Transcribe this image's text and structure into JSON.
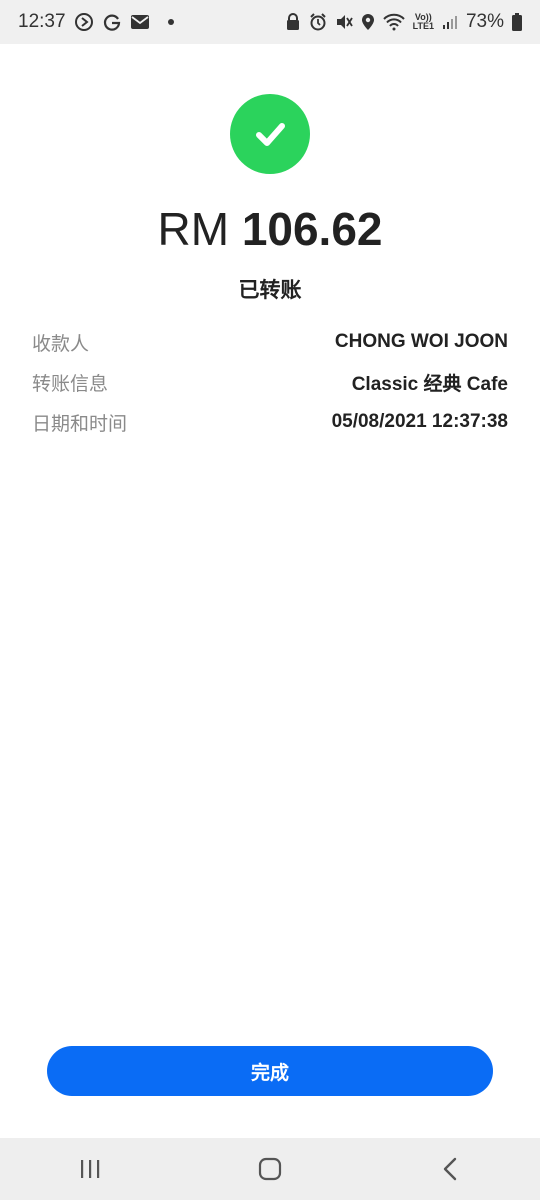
{
  "status_bar": {
    "time": "12:37",
    "battery": "73%",
    "left_icons": [
      "play-circle-icon",
      "google-icon",
      "mail-icon",
      "notification-dot"
    ],
    "right_icons": [
      "recycle-lock-icon",
      "alarm-icon",
      "mute-icon",
      "location-icon",
      "wifi-icon",
      "volte-icon",
      "signal-icon",
      "battery-icon"
    ],
    "volte_label_top": "Vo))",
    "volte_label_bottom": "LTE1"
  },
  "result": {
    "currency": "RM",
    "amount": "106.62",
    "status": "已转账",
    "success_color": "#2bd35c"
  },
  "details": [
    {
      "label": "收款人",
      "value": "CHONG WOI JOON"
    },
    {
      "label": "转账信息",
      "value": "Classic 经典 Cafe"
    },
    {
      "label": "日期和时间",
      "value": "05/08/2021 12:37:38"
    }
  ],
  "actions": {
    "done_label": "完成",
    "done_color": "#0a6cf5"
  },
  "nav_bar": {
    "buttons": [
      "recent-apps-icon",
      "home-icon",
      "back-icon"
    ]
  }
}
